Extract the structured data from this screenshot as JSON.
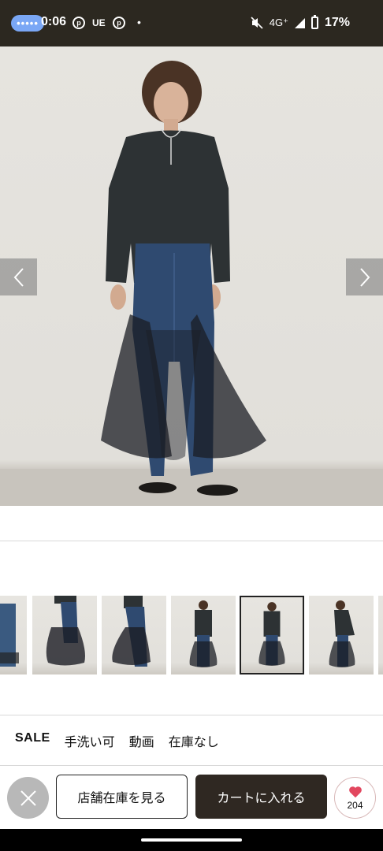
{
  "status_bar": {
    "time": "0:06",
    "carrier": "UE",
    "network": "4G⁺",
    "battery": "17%",
    "pill_dots": "•••••"
  },
  "product": {
    "tags": [
      "SALE",
      "手洗い可",
      "動画",
      "在庫なし"
    ]
  },
  "actions": {
    "store_stock_label": "店舗在庫を見る",
    "add_to_cart_label": "カートに入れる",
    "favorite_count": "204"
  },
  "thumbnails": {
    "count": 7,
    "selected_index": 4
  },
  "colors": {
    "status_bar_bg": "#2c2820",
    "cart_button_bg": "#2f2822",
    "heart": "#e2475f",
    "nav_bar_bg": "#000000"
  },
  "icons": {
    "prev": "chevron-left-icon",
    "next": "chevron-right-icon",
    "close": "close-icon",
    "favorite": "heart-icon"
  }
}
